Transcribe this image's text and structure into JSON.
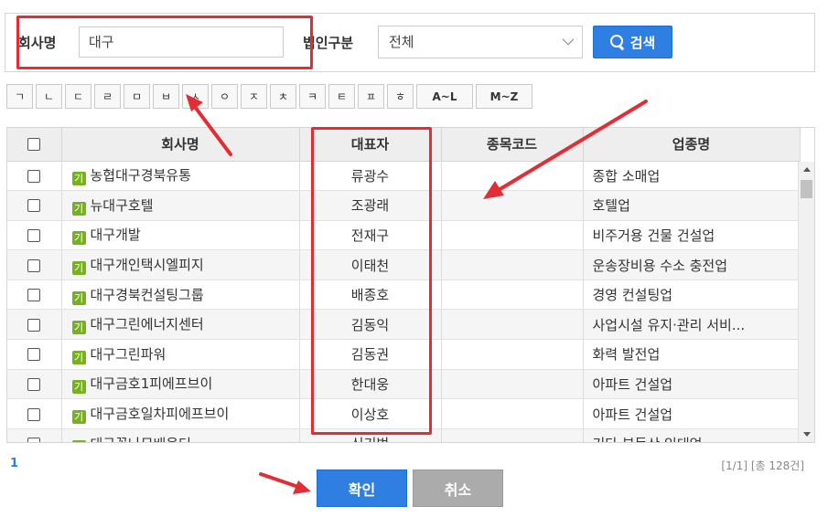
{
  "search": {
    "company_label": "회사명",
    "company_value": "대구",
    "corp_type_label": "법인구분",
    "corp_type_value": "전체",
    "search_button": "검색"
  },
  "consonants": [
    "ㄱ",
    "ㄴ",
    "ㄷ",
    "ㄹ",
    "ㅁ",
    "ㅂ",
    "ㅅ",
    "ㅇ",
    "ㅈ",
    "ㅊ",
    "ㅋ",
    "ㅌ",
    "ㅍ",
    "ㅎ"
  ],
  "range_buttons": [
    "A~L",
    "M~Z"
  ],
  "table": {
    "headers": [
      "회사명",
      "대표자",
      "종목코드",
      "업종명"
    ],
    "badge": "기",
    "rows": [
      {
        "company": "농협대구경북유통",
        "ceo": "류광수",
        "code": "",
        "industry": "종합 소매업"
      },
      {
        "company": "뉴대구호텔",
        "ceo": "조광래",
        "code": "",
        "industry": "호텔업"
      },
      {
        "company": "대구개발",
        "ceo": "전재구",
        "code": "",
        "industry": "비주거용 건물 건설업"
      },
      {
        "company": "대구개인택시엘피지",
        "ceo": "이태천",
        "code": "",
        "industry": "운송장비용 수소 충전업"
      },
      {
        "company": "대구경북컨설팅그룹",
        "ceo": "배종호",
        "code": "",
        "industry": "경영 컨설팅업"
      },
      {
        "company": "대구그린에너지센터",
        "ceo": "김동익",
        "code": "",
        "industry": "사업시설 유지·관리 서비..."
      },
      {
        "company": "대구그린파워",
        "ceo": "김동권",
        "code": "",
        "industry": "화력 발전업"
      },
      {
        "company": "대구금호1피에프브이",
        "ceo": "한대웅",
        "code": "",
        "industry": "아파트 건설업"
      },
      {
        "company": "대구금호일차피에프브이",
        "ceo": "이상호",
        "code": "",
        "industry": "아파트 건설업"
      },
      {
        "company": "대구꽃나무배움터",
        "ceo": "신기범",
        "code": "",
        "industry": "기타 부동산 임대업"
      }
    ]
  },
  "pagination": {
    "current": "1",
    "info": "[1/1] [총 128건]"
  },
  "buttons": {
    "ok": "확인",
    "cancel": "취소"
  },
  "colors": {
    "primary": "#2f7fe3",
    "annotation": "#e32d34",
    "badge": "#77b11f"
  }
}
